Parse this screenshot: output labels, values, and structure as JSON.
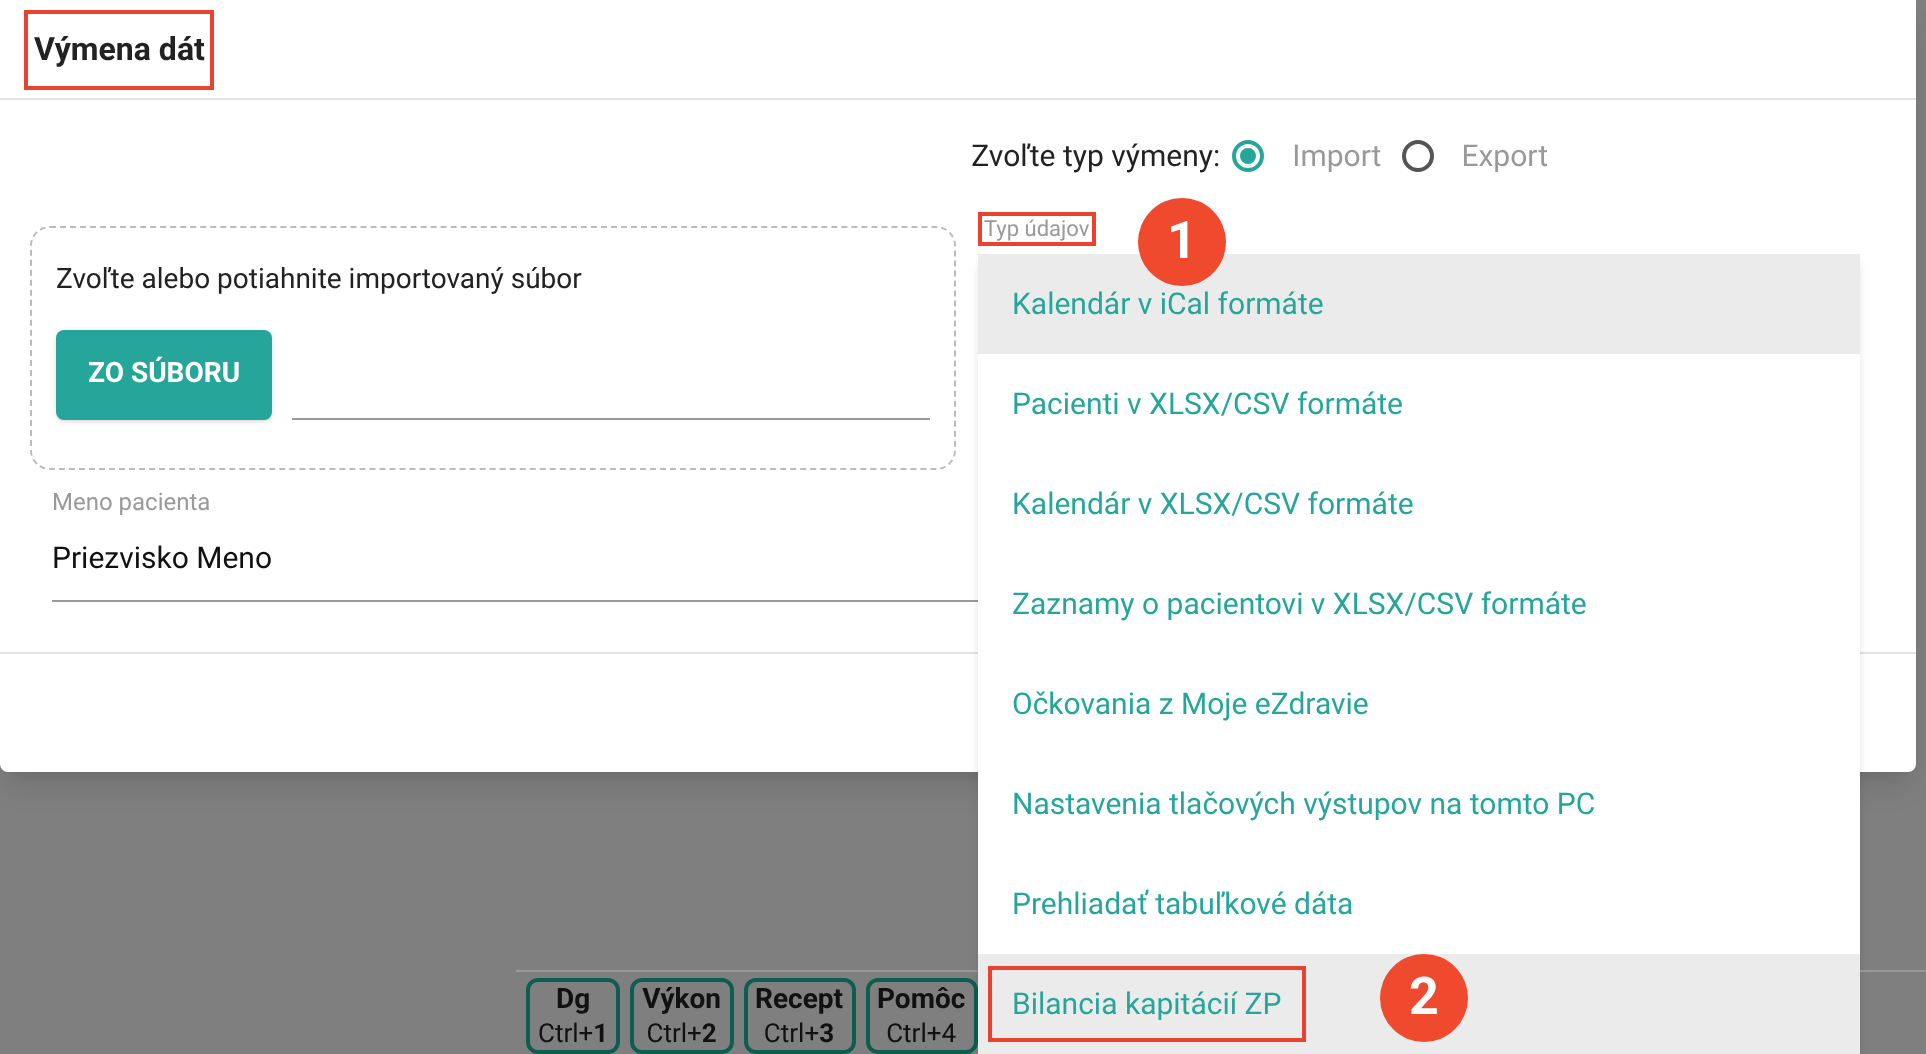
{
  "dialog": {
    "title": "Výmena dát",
    "title_outlined": true,
    "exchange_type": {
      "label": "Zvoľte typ výmeny:",
      "options": [
        {
          "label": "Import",
          "selected": true
        },
        {
          "label": "Export",
          "selected": false
        }
      ]
    },
    "dropzone": {
      "text": "Zvoľte alebo potiahnite importovaný súbor",
      "button": "ZO SÚBORU"
    },
    "patient": {
      "label": "Meno pacienta",
      "value": "Priezvisko Meno"
    },
    "data_type": {
      "label": "Typ údajov",
      "outlined": true,
      "callout": "1"
    }
  },
  "menu": {
    "items": [
      {
        "label": "Kalendár v iCal formáte",
        "highlighted": true,
        "outlined": false
      },
      {
        "label": "Pacienti v XLSX/CSV formáte",
        "highlighted": false,
        "outlined": false
      },
      {
        "label": "Kalendár v XLSX/CSV formáte",
        "highlighted": false,
        "outlined": false
      },
      {
        "label": "Zaznamy o pacientovi v XLSX/CSV formáte",
        "highlighted": false,
        "outlined": false
      },
      {
        "label": "Očkovania z Moje eZdravie",
        "highlighted": false,
        "outlined": false
      },
      {
        "label": "Nastavenia tlačových výstupov na tomto PC",
        "highlighted": false,
        "outlined": false
      },
      {
        "label": "Prehliadať tabuľkové dáta",
        "highlighted": false,
        "outlined": false
      },
      {
        "label": "Bilancia kapitácií ZP",
        "highlighted": true,
        "outlined": true,
        "callout": "2"
      }
    ]
  },
  "toolbar": [
    {
      "label": "Dg",
      "shortcut": "Ctrl+**1**"
    },
    {
      "label": "Výkon",
      "shortcut": "Ctrl+**2**"
    },
    {
      "label": "Recept",
      "shortcut": "Ctrl+**3**"
    },
    {
      "label": "Pomôc",
      "shortcut": "Ctrl+4"
    }
  ]
}
